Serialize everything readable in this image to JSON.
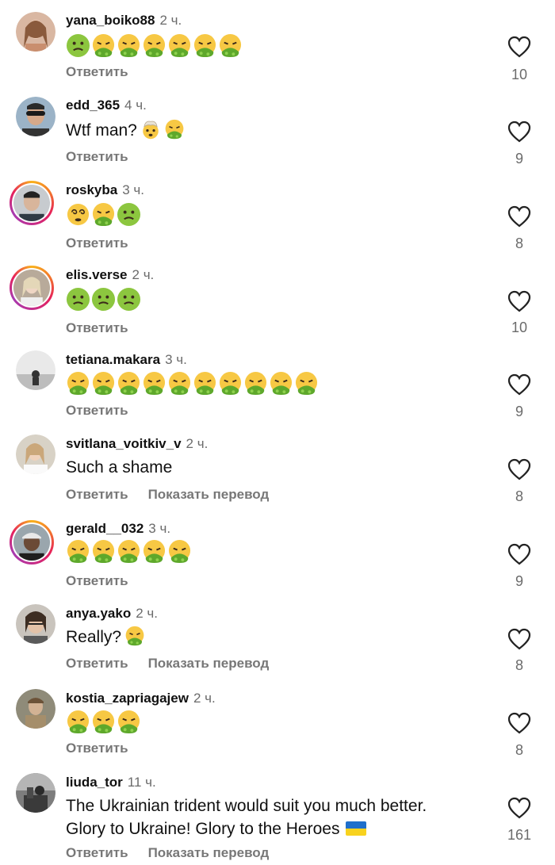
{
  "actions": {
    "reply_label": "Ответить",
    "translate_label": "Показать перевод"
  },
  "comments": [
    {
      "username": "yana_boiko88",
      "time": "2 ч.",
      "emojis": [
        "nauseated-face-icon",
        "vomiting-face-icon",
        "vomiting-face-icon",
        "vomiting-face-icon",
        "vomiting-face-icon",
        "vomiting-face-icon",
        "vomiting-face-icon"
      ],
      "likes": "10",
      "has_translate": false
    },
    {
      "username": "edd_365",
      "time": "4 ч.",
      "text": "Wtf man?",
      "inline_emojis": [
        "exploding-head-icon",
        "vomiting-face-icon"
      ],
      "likes": "9",
      "has_translate": false
    },
    {
      "username": "roskyba",
      "time": "3 ч.",
      "emojis": [
        "dizzy-face-icon",
        "vomiting-face-icon",
        "nauseated-face-icon"
      ],
      "likes": "8",
      "has_translate": false
    },
    {
      "username": "elis.verse",
      "time": "2 ч.",
      "emojis": [
        "nauseated-face-icon",
        "nauseated-face-icon",
        "nauseated-face-icon"
      ],
      "likes": "10",
      "has_translate": false
    },
    {
      "username": "tetiana.makara",
      "time": "3 ч.",
      "emojis": [
        "vomiting-face-icon",
        "vomiting-face-icon",
        "vomiting-face-icon",
        "vomiting-face-icon",
        "vomiting-face-icon",
        "vomiting-face-icon",
        "vomiting-face-icon",
        "vomiting-face-icon",
        "vomiting-face-icon",
        "vomiting-face-icon"
      ],
      "likes": "9",
      "has_translate": false
    },
    {
      "username": "svitlana_voitkiv_v",
      "time": "2 ч.",
      "text": "Such a shame",
      "likes": "8",
      "has_translate": true
    },
    {
      "username": "gerald__032",
      "time": "3 ч.",
      "emojis": [
        "vomiting-face-icon",
        "vomiting-face-icon",
        "vomiting-face-icon",
        "vomiting-face-icon",
        "vomiting-face-icon"
      ],
      "likes": "9",
      "has_translate": false
    },
    {
      "username": "anya.yako",
      "time": "2 ч.",
      "text": "Really?",
      "inline_emojis": [
        "vomiting-face-icon"
      ],
      "likes": "8",
      "has_translate": true
    },
    {
      "username": "kostia_zapriagajew",
      "time": "2 ч.",
      "emojis": [
        "vomiting-face-icon",
        "vomiting-face-icon",
        "vomiting-face-icon"
      ],
      "likes": "8",
      "has_translate": false
    },
    {
      "username": "liuda_tor",
      "time": "11 ч.",
      "text_lines": [
        "The Ukrainian trident would suit you much better.",
        "Glory to Ukraine! Glory to the Heroes"
      ],
      "likes": "161",
      "has_translate": true
    }
  ]
}
